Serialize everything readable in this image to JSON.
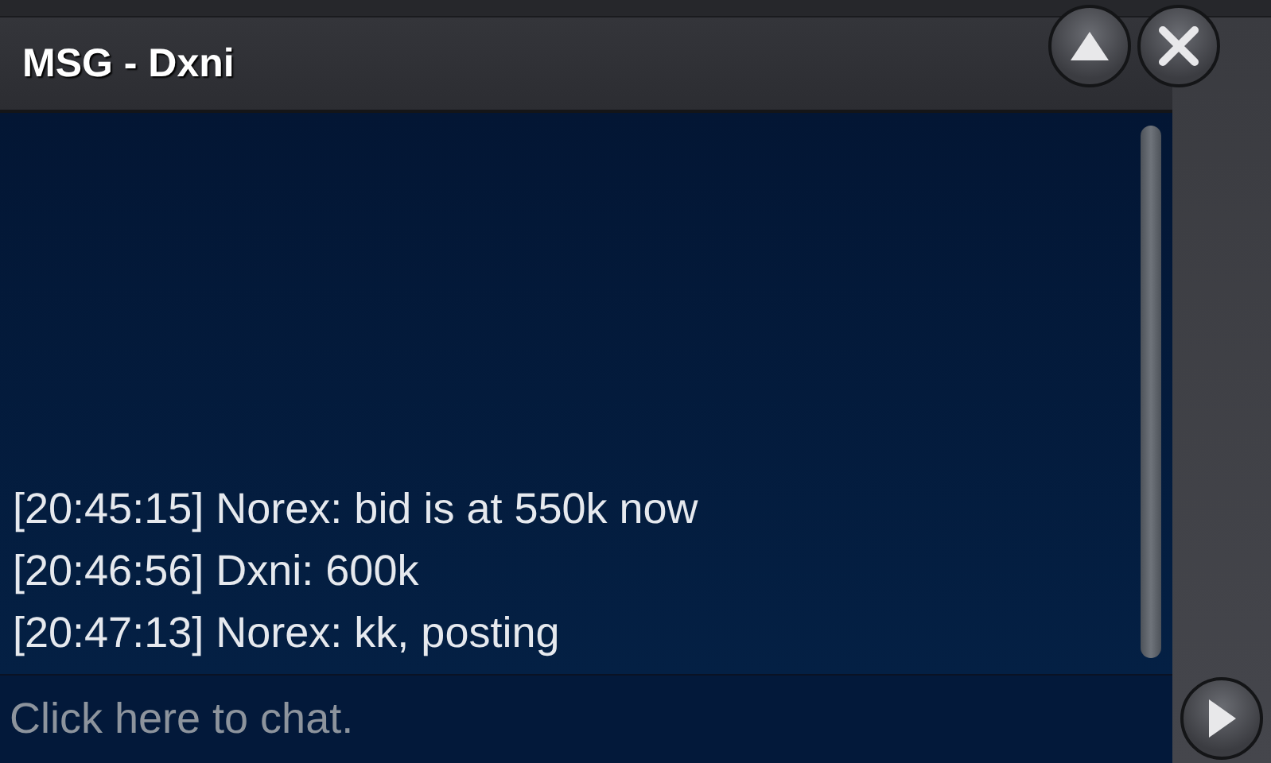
{
  "window": {
    "title": "MSG - Dxni"
  },
  "messages": [
    {
      "time": "[20:45:15]",
      "sender": "Norex:",
      "text": "bid is at 550k now"
    },
    {
      "time": "[20:46:56]",
      "sender": "Dxni:",
      "text": "600k"
    },
    {
      "time": "[20:47:13]",
      "sender": "Norex:",
      "text": "kk, posting"
    }
  ],
  "chat_input": {
    "placeholder": "Click here to chat."
  }
}
